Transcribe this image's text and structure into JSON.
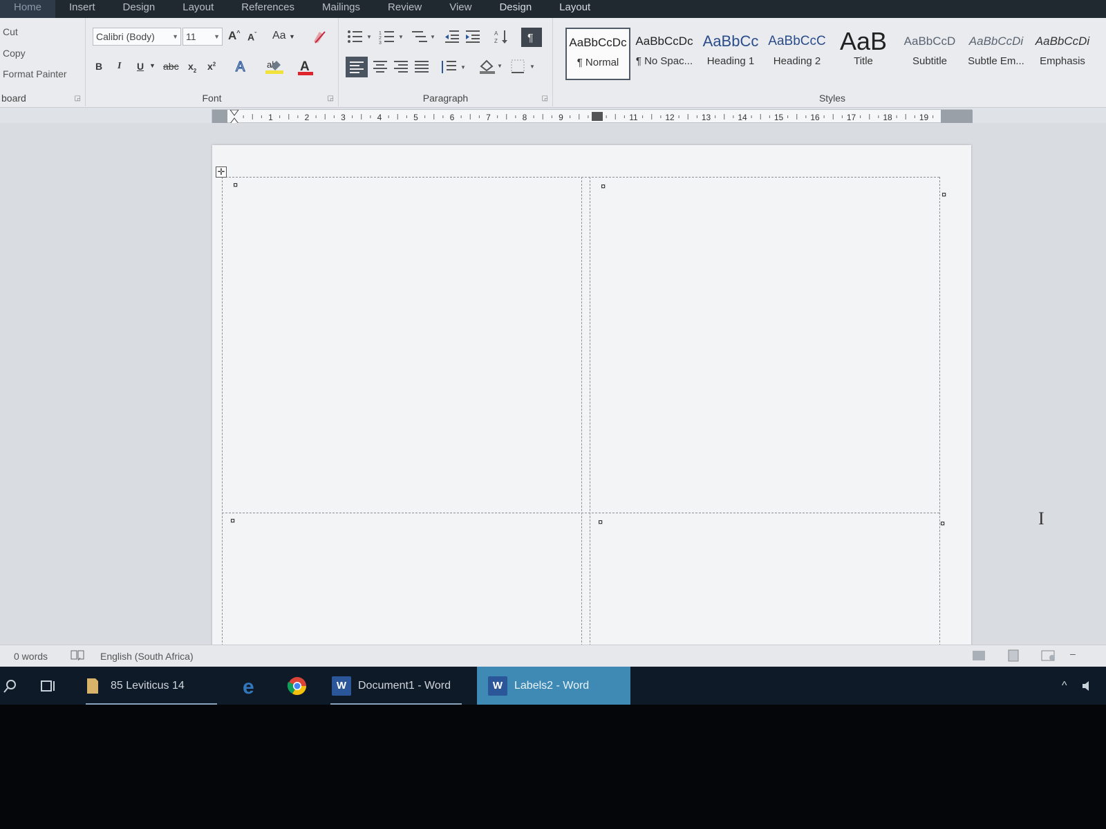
{
  "ribbon_tabs": [
    "Home",
    "Insert",
    "Design",
    "Layout",
    "References",
    "Mailings",
    "Review",
    "View",
    "Design",
    "Layout"
  ],
  "clipboard": {
    "cut": "Cut",
    "copy": "Copy",
    "format_painter": "Format Painter",
    "label": "board"
  },
  "font": {
    "label": "Font",
    "family": "Calibri (Body)",
    "size": "11",
    "grow": "A",
    "shrink": "A",
    "change_case": "Aa",
    "bold": "B",
    "italic": "I",
    "underline": "U",
    "strikethrough": "abc",
    "subscript": "x",
    "superscript": "x",
    "color_letter": "A"
  },
  "paragraph": {
    "label": "Paragraph"
  },
  "styles": {
    "label": "Styles",
    "items": [
      {
        "preview": "AaBbCcDc",
        "name": "¶ Normal"
      },
      {
        "preview": "AaBbCcDc",
        "name": "¶ No Spac..."
      },
      {
        "preview": "AaBbCc",
        "name": "Heading 1"
      },
      {
        "preview": "AaBbCcC",
        "name": "Heading 2"
      },
      {
        "preview": "AaB",
        "name": "Title"
      },
      {
        "preview": "AaBbCcD",
        "name": "Subtitle"
      },
      {
        "preview": "AaBbCcDi",
        "name": "Subtle Em..."
      },
      {
        "preview": "AaBbCcDi",
        "name": "Emphasis"
      }
    ]
  },
  "ruler_numbers": [
    "1",
    "2",
    "3",
    "4",
    "5",
    "6",
    "7",
    "8",
    "9",
    "11",
    "12",
    "13",
    "14",
    "15",
    "16",
    "17",
    "18",
    "19"
  ],
  "table": {
    "cell_mark": "¤"
  },
  "status": {
    "words": "0 words",
    "language": "English (South Africa)"
  },
  "taskbar": {
    "folder": "85 Leviticus 14",
    "doc1": "Document1 - Word",
    "doc2": "Labels2 - Word",
    "word_letter": "W"
  }
}
